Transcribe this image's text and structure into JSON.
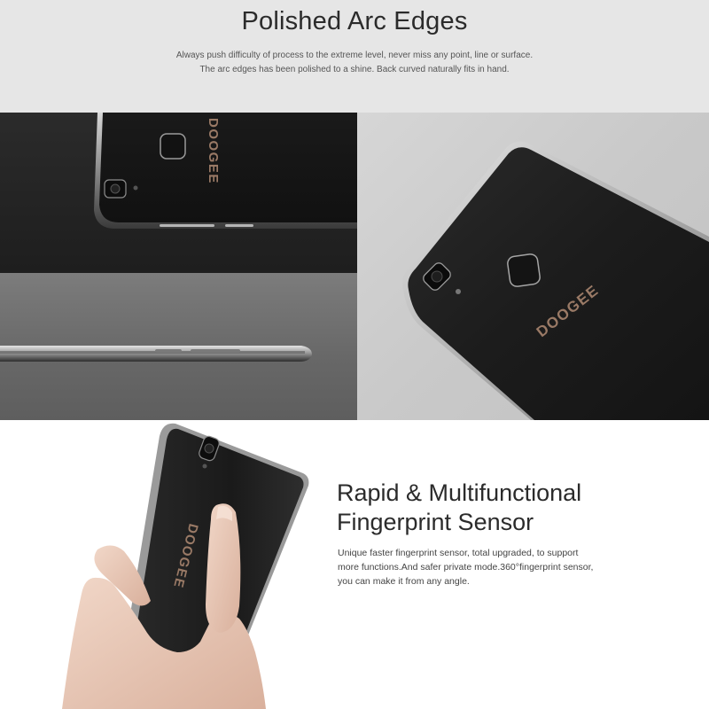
{
  "header": {
    "title": "Polished Arc Edges",
    "subtitle_line1": "Always push difficulty of process to the extreme level, never miss any point, line or surface.",
    "subtitle_line2": "The arc edges has been polished to a shine. Back curved naturally fits in hand."
  },
  "brand": {
    "logo_text": "DOOGEE"
  },
  "feature": {
    "title_line1": "Rapid & Multifunctional",
    "title_line2": "Fingerprint Sensor",
    "text_line1": "Unique faster fingerprint sensor, total upgraded, to support",
    "text_line2": "more functions.And safer private mode.360°fingerprint sensor,",
    "text_line3": "you can make it from any angle."
  },
  "colors": {
    "header_bg": "#e6e6e6",
    "phone_body": "#1b1b1b",
    "logo_bronze": "#9a7a66"
  }
}
